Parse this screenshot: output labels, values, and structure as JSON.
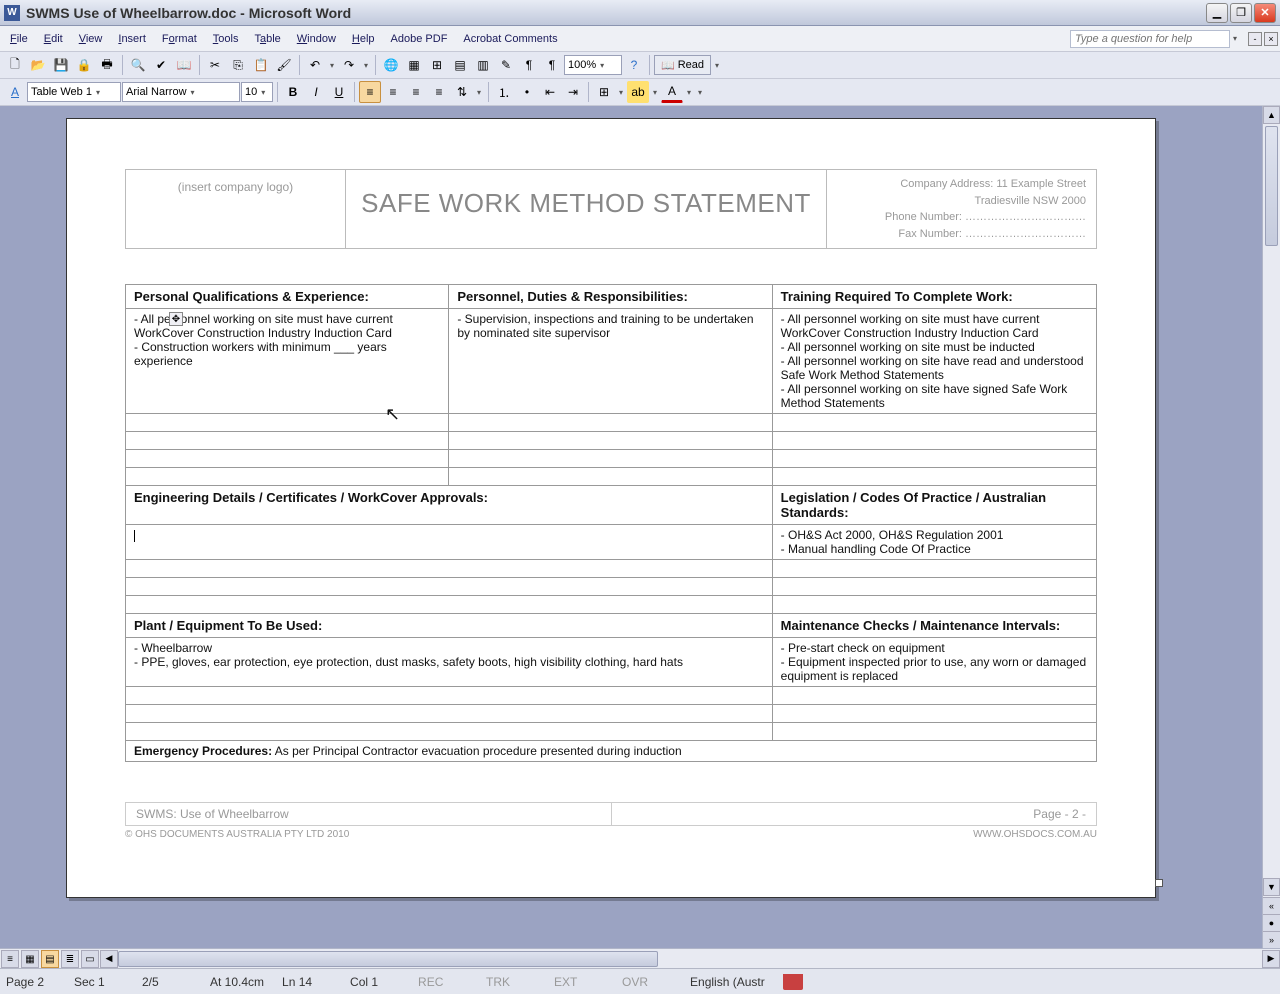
{
  "window": {
    "title": "SWMS Use of Wheelbarrow.doc - Microsoft Word"
  },
  "menu": {
    "file": "File",
    "edit": "Edit",
    "view": "View",
    "insert": "Insert",
    "format": "Format",
    "tools": "Tools",
    "table": "Table",
    "window": "Window",
    "help": "Help",
    "adobe": "Adobe PDF",
    "acrobat": "Acrobat Comments",
    "ask_placeholder": "Type a question for help"
  },
  "toolbar": {
    "zoom": "100%",
    "read": "Read",
    "style": "Table Web 1",
    "font": "Arial Narrow",
    "size": "10"
  },
  "header": {
    "logo": "(insert company logo)",
    "title": "SAFE WORK METHOD STATEMENT",
    "addr1": "Company Address: 11 Example Street",
    "addr2": "Tradiesville NSW 2000",
    "phone": "Phone Number: ……………………………",
    "fax": "Fax Number: ……………………………"
  },
  "sec1": {
    "h1": "Personal Qualifications & Experience:",
    "h2": "Personnel, Duties & Responsibilities:",
    "h3": "Training Required To Complete Work:",
    "c1a": "- All personnel working on site must have current WorkCover Construction Industry Induction Card",
    "c1b": "- Construction workers with minimum ___ years experience",
    "c2": "- Supervision, inspections and training to be undertaken by nominated site supervisor",
    "c3a": "- All personnel working on site must have current WorkCover Construction Industry Induction Card",
    "c3b": "- All personnel working on site must be inducted",
    "c3c": "- All personnel working on site have read and understood Safe Work Method Statements",
    "c3d": "- All personnel working on site have signed Safe Work Method Statements"
  },
  "sec2": {
    "h1": "Engineering Details / Certificates / WorkCover Approvals:",
    "h2": "Legislation / Codes Of Practice / Australian Standards:",
    "c2a": "- OH&S Act 2000, OH&S Regulation 2001",
    "c2b": "- Manual handling Code Of Practice"
  },
  "sec3": {
    "h1": "Plant / Equipment To Be Used:",
    "h2": "Maintenance Checks / Maintenance Intervals:",
    "c1a": "- Wheelbarrow",
    "c1b": "- PPE, gloves, ear protection, eye protection, dust masks, safety boots, high visibility clothing, hard hats",
    "c2a": "- Pre-start check on equipment",
    "c2b": "- Equipment inspected prior to use, any worn or damaged equipment is replaced"
  },
  "sec4": {
    "label": "Emergency Procedures:",
    "text": " As per Principal Contractor evacuation procedure presented during induction"
  },
  "footer": {
    "left": "SWMS: Use of Wheelbarrow",
    "right": "Page - 2 -",
    "copy": "© OHS DOCUMENTS AUSTRALIA PTY LTD 2010",
    "url": "WWW.OHSDOCS.COM.AU"
  },
  "status": {
    "page": "Page 2",
    "sec": "Sec 1",
    "pages": "2/5",
    "at": "At 10.4cm",
    "ln": "Ln 14",
    "col": "Col 1",
    "rec": "REC",
    "trk": "TRK",
    "ext": "EXT",
    "ovr": "OVR",
    "lang": "English (Austr"
  }
}
